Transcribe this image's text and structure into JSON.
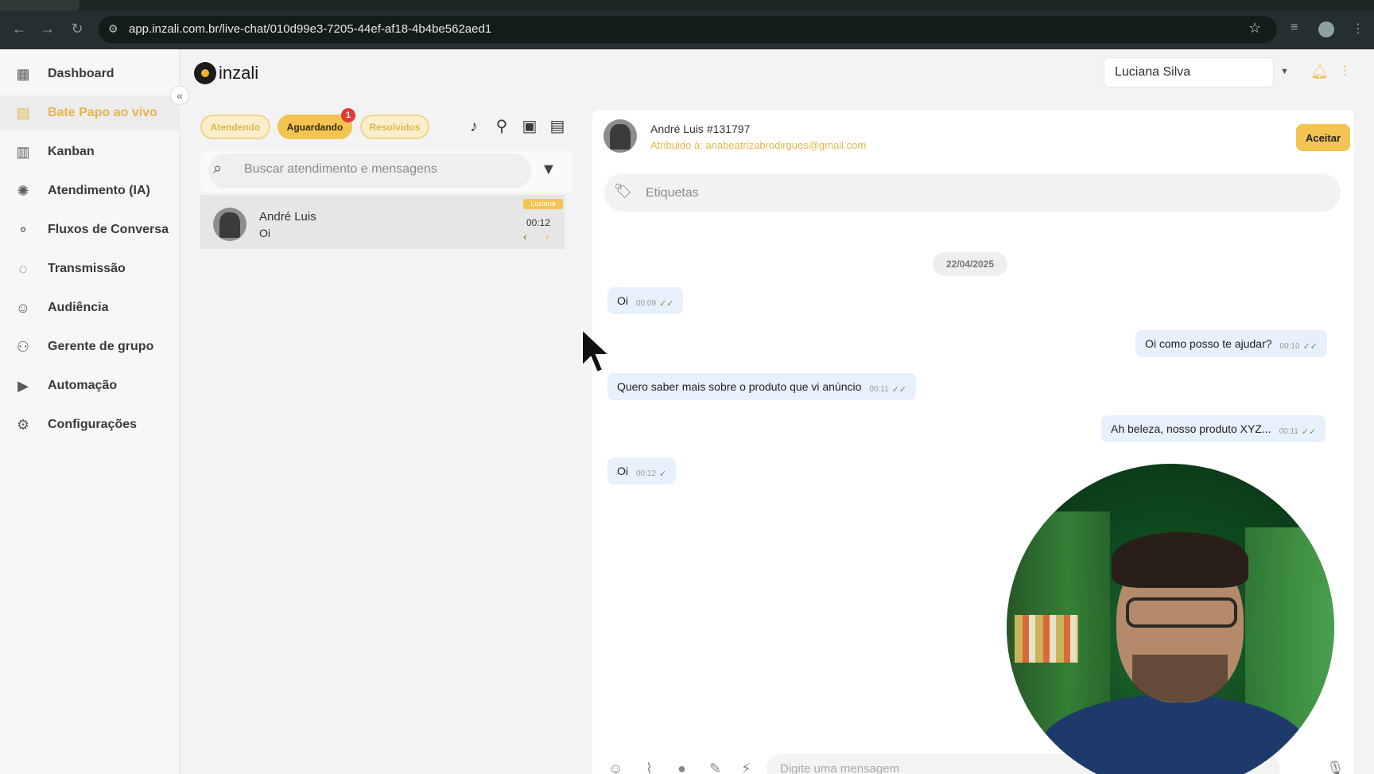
{
  "browser": {
    "url": "app.inzali.com.br/live-chat/010d99e3-7205-44ef-af18-4b4be562aed1"
  },
  "app": {
    "logo_text": "inzali",
    "user_selector": "Luciana Silva"
  },
  "sidebar": {
    "items": [
      {
        "label": "Dashboard",
        "icon": "dashboard-icon",
        "active": false
      },
      {
        "label": "Bate Papo ao vivo",
        "icon": "chat-icon",
        "active": true
      },
      {
        "label": "Kanban",
        "icon": "kanban-icon",
        "active": false
      },
      {
        "label": "Atendimento (IA)",
        "icon": "ai-icon",
        "active": false
      },
      {
        "label": "Fluxos de Conversa",
        "icon": "flow-icon",
        "active": false
      },
      {
        "label": "Transmissão",
        "icon": "broadcast-icon",
        "active": false
      },
      {
        "label": "Audiência",
        "icon": "audience-icon",
        "active": false
      },
      {
        "label": "Gerente de grupo",
        "icon": "group-manager-icon",
        "active": false
      },
      {
        "label": "Automação",
        "icon": "play-icon",
        "active": false
      },
      {
        "label": "Configurações",
        "icon": "gear-icon",
        "active": false
      }
    ]
  },
  "conversations": {
    "tabs": [
      {
        "label": "Atendendo",
        "active": false
      },
      {
        "label": "Aguardando",
        "active": true,
        "badge": "1"
      },
      {
        "label": "Resolvidos",
        "active": false
      }
    ],
    "search_placeholder": "Buscar atendimento e mensagens",
    "items": [
      {
        "name": "André Luis",
        "last_message": "Oi",
        "tag": "Luciana",
        "time": "00:12"
      }
    ]
  },
  "chat": {
    "contact_name": "André Luis #131797",
    "assigned": "Atribuido à: anabeatrizabrodirgues@gmail.com",
    "accept_label": "Aceitar",
    "tags_placeholder": "Etiquetas",
    "date": "22/04/2025",
    "messages": [
      {
        "text": "Oi",
        "time": "00:09",
        "direction": "in",
        "ticks": "double"
      },
      {
        "text": "Oi como posso te ajudar?",
        "time": "00:10",
        "direction": "out",
        "ticks": "double"
      },
      {
        "text": "Quero saber mais sobre o produto que vi anúncio",
        "time": "00:11",
        "direction": "in",
        "ticks": "double"
      },
      {
        "text": "Ah beleza, nosso produto XYZ...",
        "time": "00:11",
        "direction": "out",
        "ticks": "double"
      },
      {
        "text": "Oi",
        "time": "00:12",
        "direction": "in",
        "ticks": "single"
      }
    ],
    "composer_placeholder": "Digite uma mensagem"
  },
  "colors": {
    "accent": "#f4c452",
    "accent_text": "#e7b64a",
    "bubble": "#e8f0fc",
    "badge": "#e53935"
  }
}
